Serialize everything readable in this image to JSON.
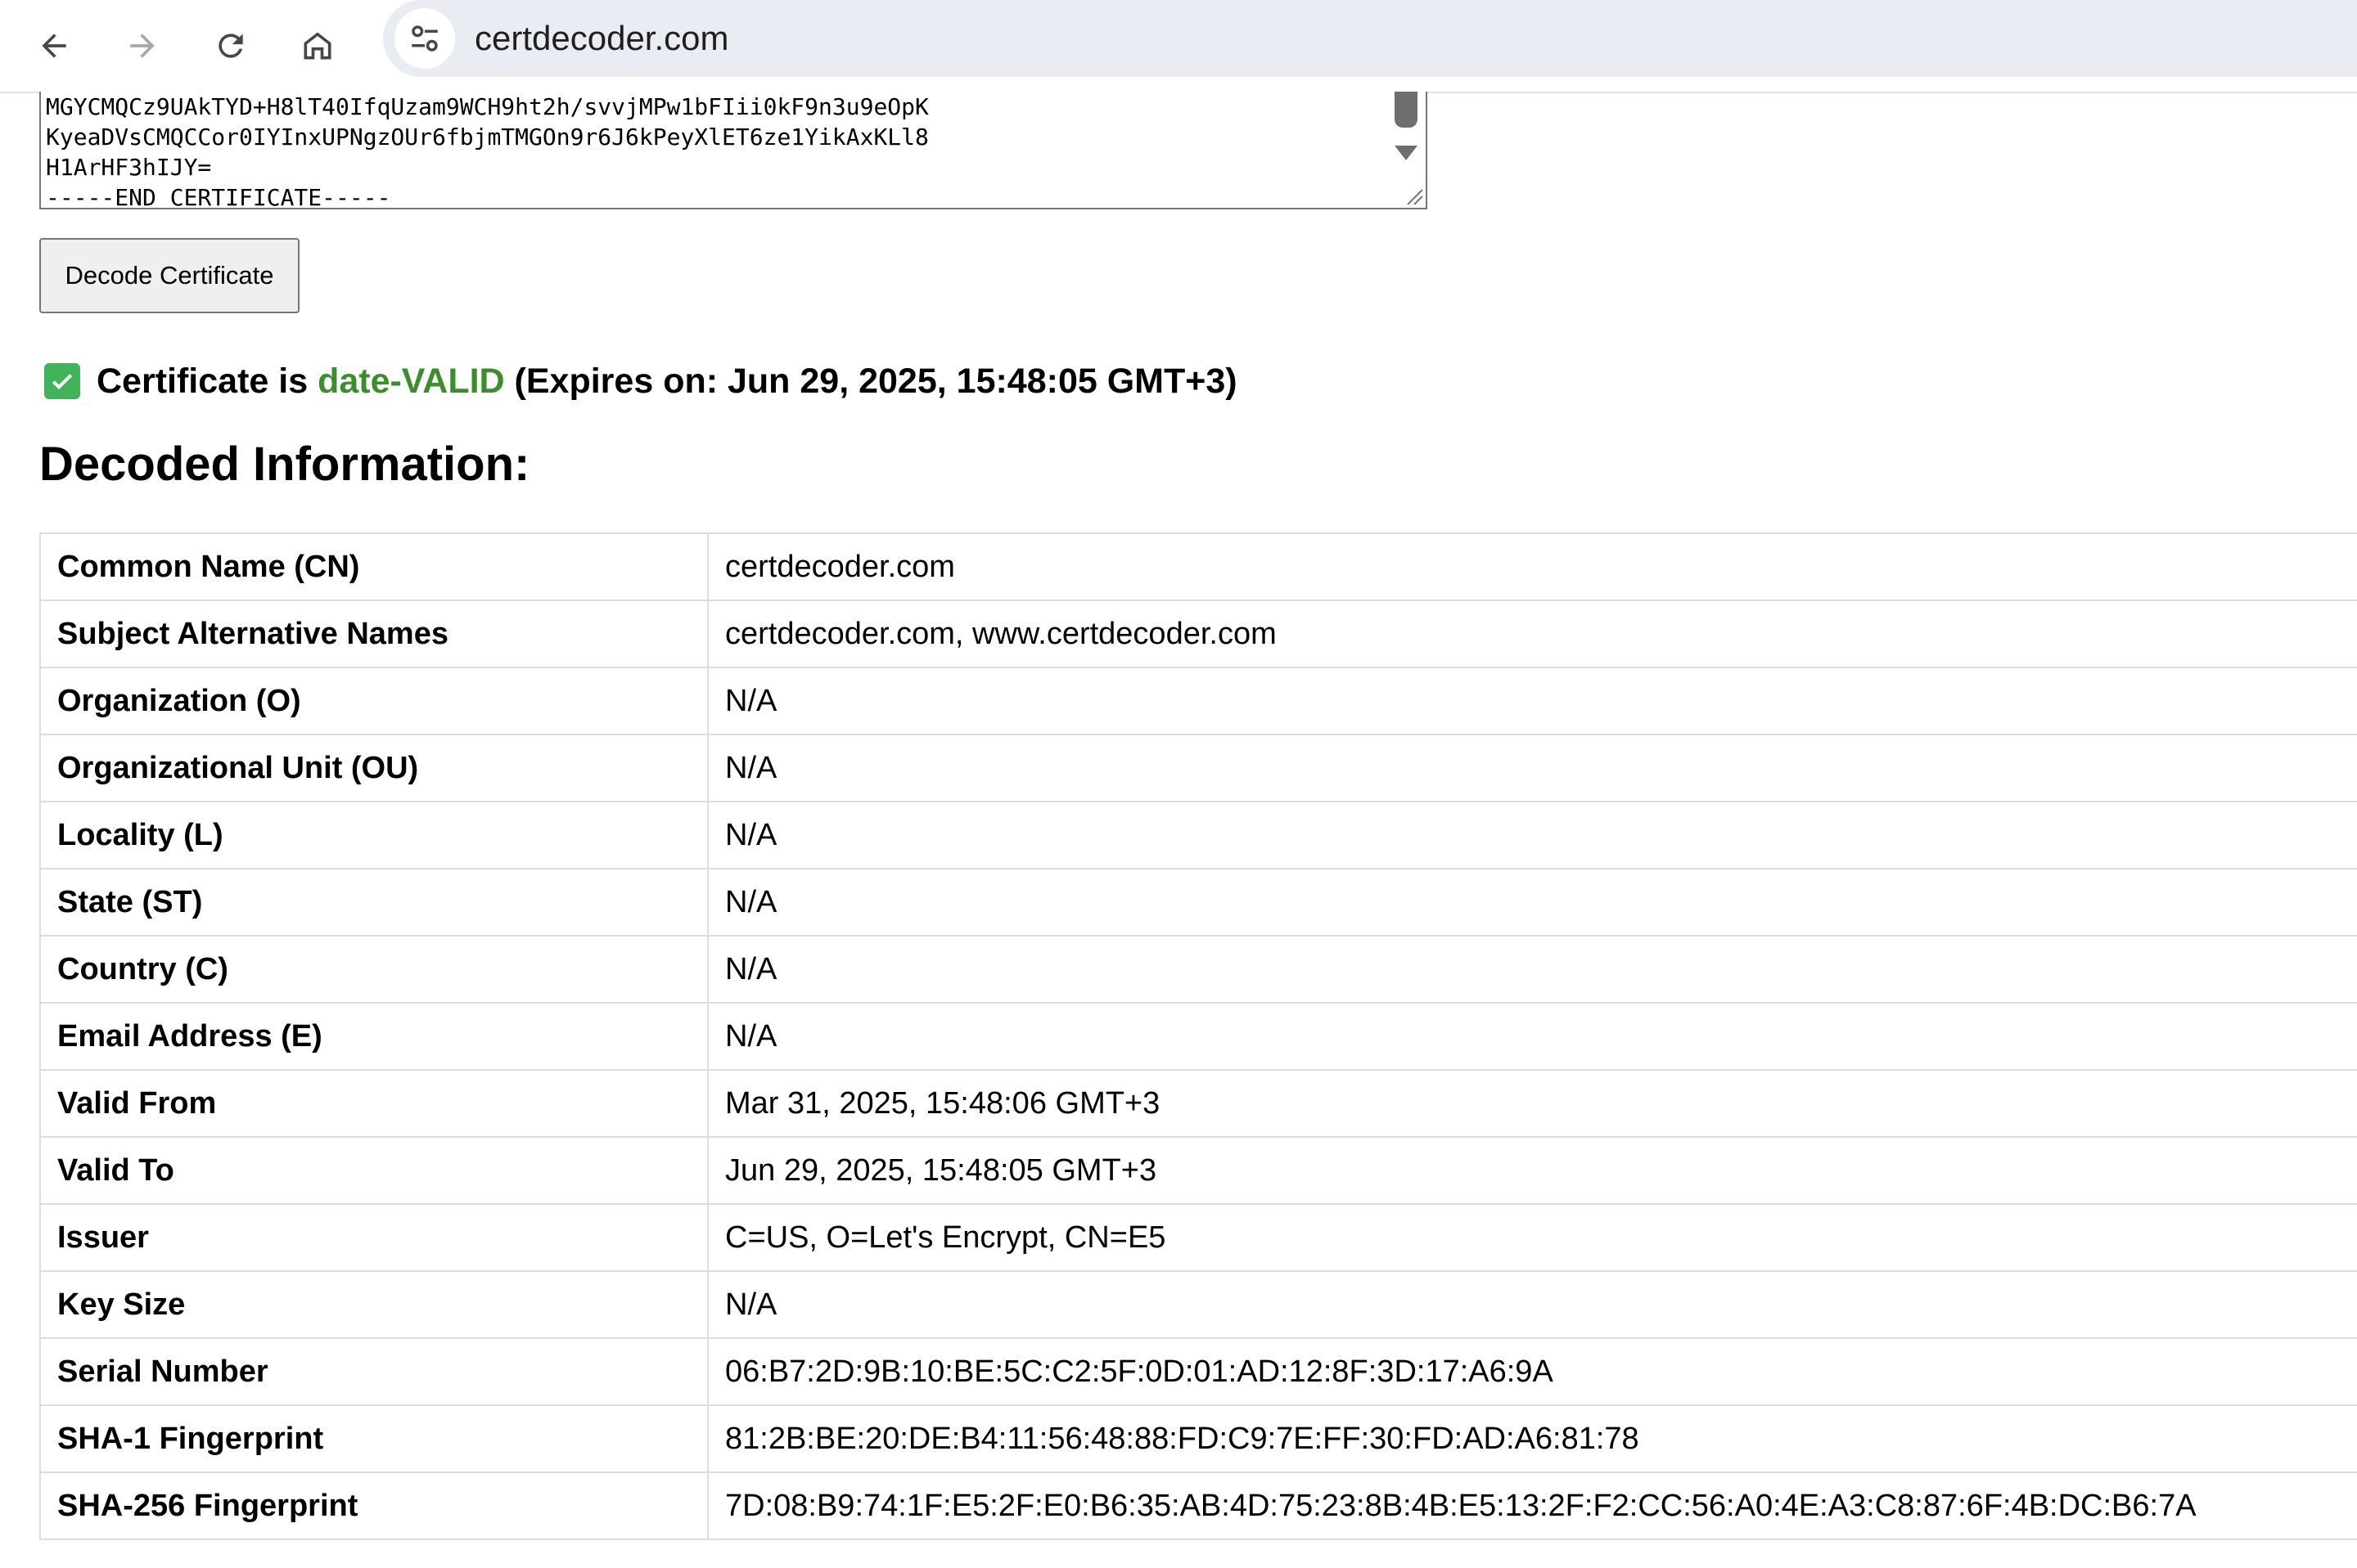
{
  "browser": {
    "url": "certdecoder.com",
    "icons": {
      "back": "arrow-left-icon",
      "forward": "arrow-right-icon",
      "reload": "reload-icon",
      "home": "home-icon",
      "site_info": "tune-icon"
    }
  },
  "certificate_input": {
    "lines": [
      "MGYCMQCz9UAkTYD+H8lT40IfqUzam9WCH9ht2h/svvjMPw1bFIii0kF9n3u9eOpK",
      "KyeaDVsCMQCCor0IYInxUPNgzOUr6fbjmTMGOn9r6J6kPeyXlET6ze1YikAxKLl8",
      "H1ArHF3hIJY=",
      "-----END CERTIFICATE-----"
    ]
  },
  "decode_button": {
    "label": "Decode Certificate"
  },
  "status": {
    "prefix": "Certificate is ",
    "valid_text": "date-VALID",
    "suffix": " (Expires on: Jun 29, 2025, 15:48:05 GMT+3)",
    "valid_color": "#3b8f2a",
    "icon": "check-box-icon"
  },
  "decoded": {
    "title": "Decoded Information:",
    "rows": [
      {
        "label": "Common Name (CN)",
        "value": "certdecoder.com"
      },
      {
        "label": "Subject Alternative Names",
        "value": "certdecoder.com, www.certdecoder.com"
      },
      {
        "label": "Organization (O)",
        "value": "N/A"
      },
      {
        "label": "Organizational Unit (OU)",
        "value": "N/A"
      },
      {
        "label": "Locality (L)",
        "value": "N/A"
      },
      {
        "label": "State (ST)",
        "value": "N/A"
      },
      {
        "label": "Country (C)",
        "value": "N/A"
      },
      {
        "label": "Email Address (E)",
        "value": "N/A"
      },
      {
        "label": "Valid From",
        "value": "Mar 31, 2025, 15:48:06 GMT+3"
      },
      {
        "label": "Valid To",
        "value": "Jun 29, 2025, 15:48:05 GMT+3"
      },
      {
        "label": "Issuer",
        "value": "C=US, O=Let's Encrypt, CN=E5"
      },
      {
        "label": "Key Size",
        "value": "N/A"
      },
      {
        "label": "Serial Number",
        "value": "06:B7:2D:9B:10:BE:5C:C2:5F:0D:01:AD:12:8F:3D:17:A6:9A"
      },
      {
        "label": "SHA-1 Fingerprint",
        "value": "81:2B:BE:20:DE:B4:11:56:48:88:FD:C9:7E:FF:30:FD:AD:A6:81:78"
      },
      {
        "label": "SHA-256 Fingerprint",
        "value": "7D:08:B9:74:1F:E5:2F:E0:B6:35:AB:4D:75:23:8B:4B:E5:13:2F:F2:CC:56:A0:4E:A3:C8:87:6F:4B:DC:B6:7A"
      }
    ]
  }
}
